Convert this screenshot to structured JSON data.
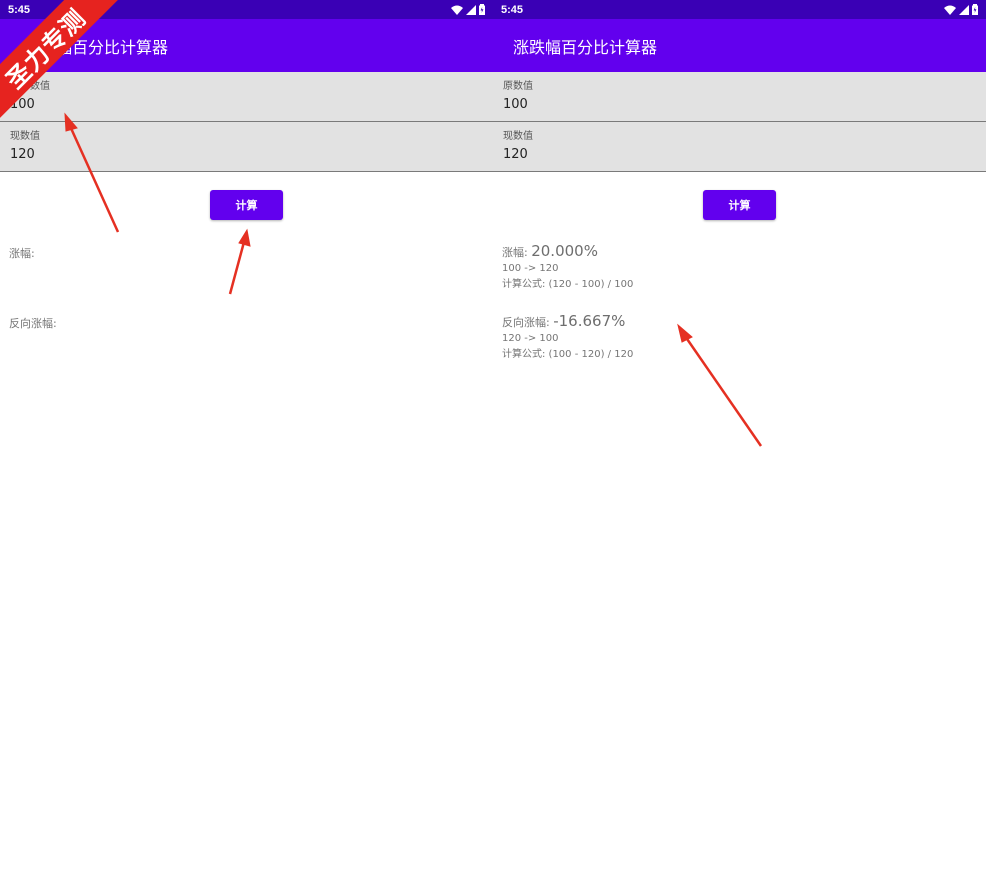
{
  "status_bar": {
    "time": "5:45"
  },
  "app_title": "涨跌幅百分比计算器",
  "left_app_title": "幅百分比计算器",
  "fields": {
    "original": {
      "label": "原数值",
      "value": "100"
    },
    "current": {
      "label": "现数值",
      "value": "120"
    }
  },
  "left_partial_label": "数值",
  "calc_button_label": "计算",
  "results": {
    "increase_label": "涨幅:",
    "increase_value": "20.000%",
    "increase_detail": "100 -> 120",
    "increase_formula": "计算公式: (120 - 100) / 100",
    "reverse_label": "反向涨幅:",
    "reverse_value": "-16.667%",
    "reverse_detail": "120 -> 100",
    "reverse_formula": "计算公式: (100 - 120) / 120"
  },
  "watermark": "圣力专测",
  "colors": {
    "status_bar": "#3a00b5",
    "app_bar": "#6200ee",
    "button": "#6200ee",
    "field_bg": "#e2e2e2",
    "annotation_arrow": "#e53022",
    "watermark": "#e6231f"
  },
  "icons": [
    "wifi-icon",
    "signal-icon",
    "battery-icon"
  ]
}
